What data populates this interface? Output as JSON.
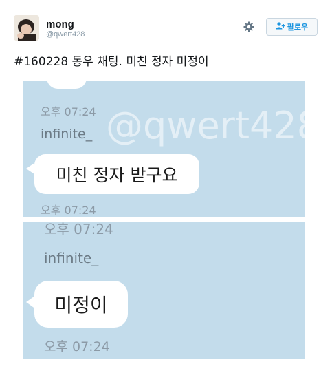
{
  "tweet": {
    "author_name": "mong",
    "author_handle": "@qwert428",
    "follow_label": "팔로우",
    "text": "#160228 동우 채팅. 미친 정자 미정이"
  },
  "screenshot_1": {
    "watermark": "@qwert428",
    "top_time": "오후 07:24",
    "sender": "infinite_",
    "message": "미친 정자 받구요",
    "bottom_time": "오후 07:24"
  },
  "screenshot_2": {
    "top_time": "오후 07:24",
    "sender": "infinite_",
    "message": "미정이",
    "bottom_time": "오후 07:24"
  },
  "icons": {
    "settings": "gear-icon",
    "follow": "add-user-icon"
  },
  "colors": {
    "chat_background": "#c3dceb",
    "follow_text": "#1b95e0"
  }
}
